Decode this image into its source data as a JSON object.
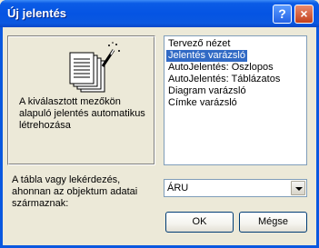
{
  "window": {
    "title": "Új jelentés",
    "help_glyph": "?",
    "close_glyph": "×"
  },
  "preview": {
    "description": "A kiválasztott mezőkön\nalapuló jelentés automatikus\nlétrehozása",
    "icon": "report-wizard-icon"
  },
  "report_types": [
    {
      "label": "Tervező nézet",
      "selected": false
    },
    {
      "label": "Jelentés varázsló",
      "selected": true
    },
    {
      "label": "AutoJelentés: Oszlopos",
      "selected": false
    },
    {
      "label": "AutoJelentés: Táblázatos",
      "selected": false
    },
    {
      "label": "Diagram varázsló",
      "selected": false
    },
    {
      "label": "Címke varázsló",
      "selected": false
    }
  ],
  "source": {
    "label": "A tábla vagy lekérdezés,\nahonnan az objektum adatai\nszármaznak:",
    "value": "ÁRU"
  },
  "buttons": {
    "ok": "OK",
    "cancel": "Mégse"
  },
  "colors": {
    "titlebar": "#0a58e0",
    "selection": "#316ac5",
    "dialog_bg": "#ece9d8"
  }
}
